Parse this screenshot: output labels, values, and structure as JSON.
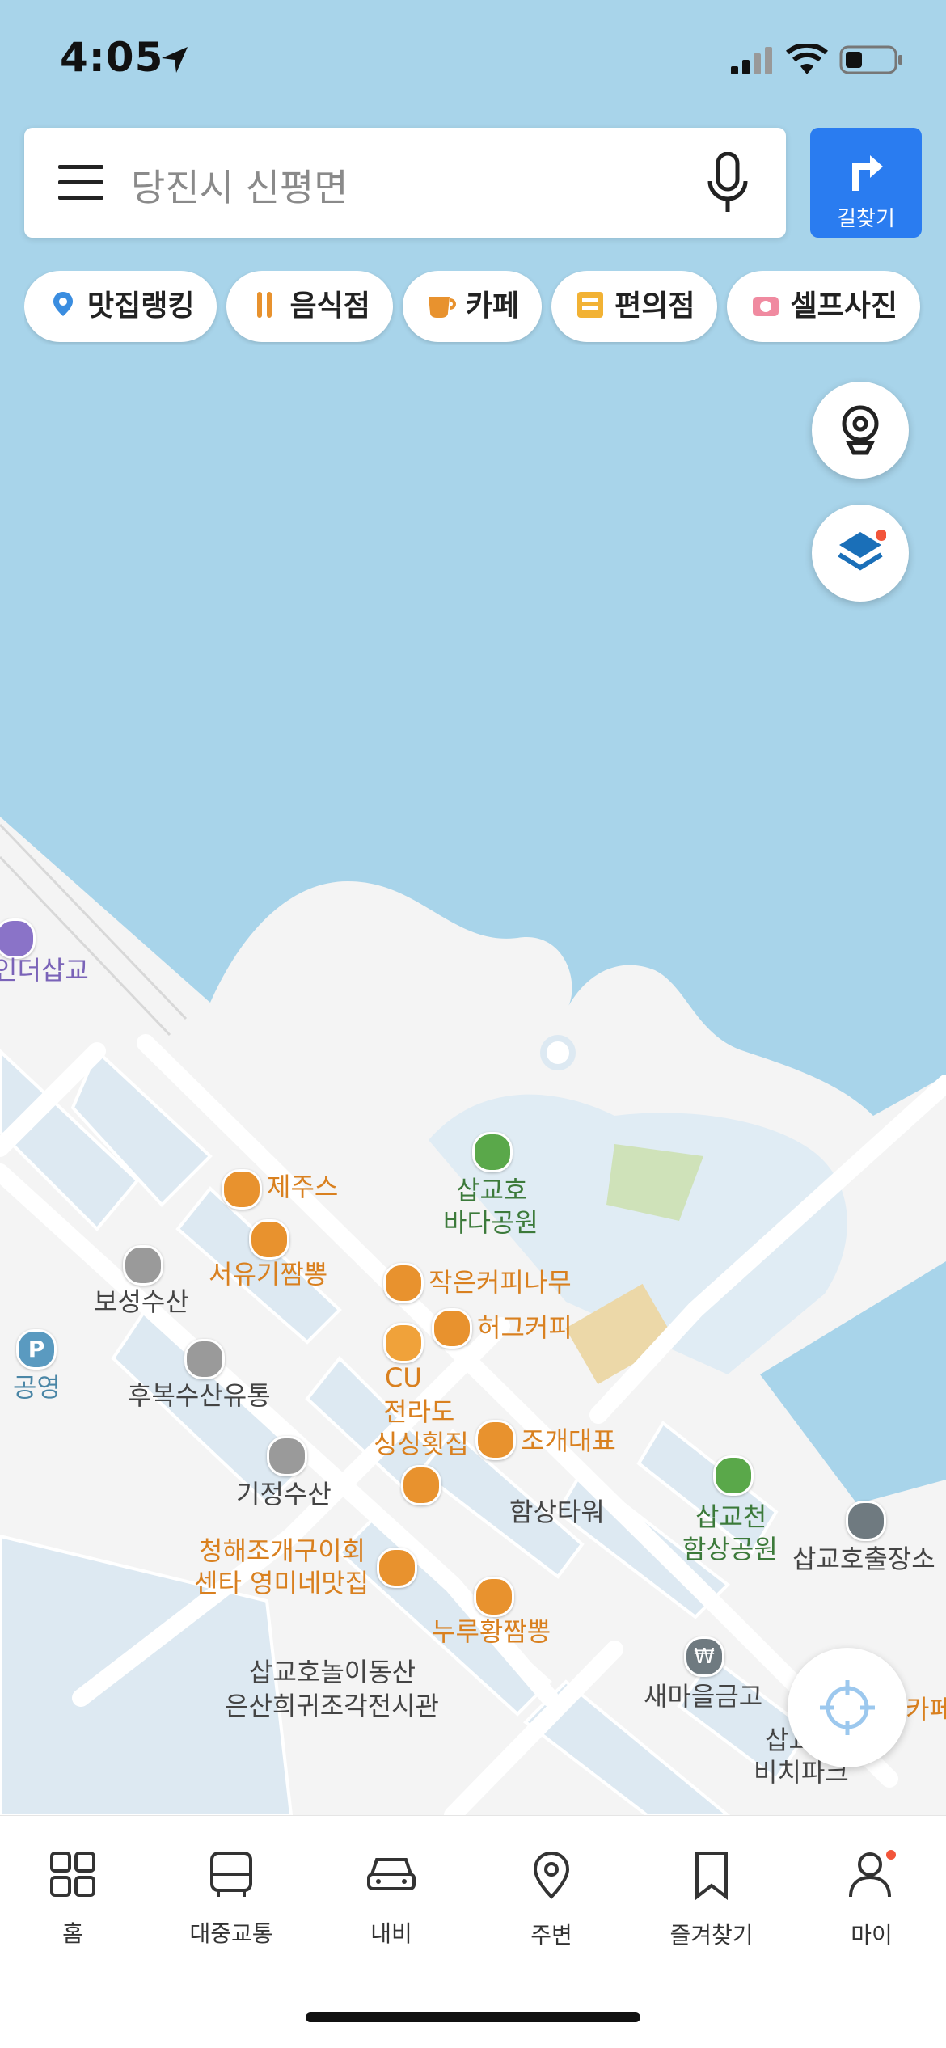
{
  "status_bar": {
    "time": "4:05"
  },
  "search": {
    "placeholder": "당진시 신평면"
  },
  "route_button": {
    "label": "길찾기"
  },
  "chips": [
    {
      "label": "맛집랭킹",
      "icon": "ranking-pin-icon"
    },
    {
      "label": "음식점",
      "icon": "utensils-icon"
    },
    {
      "label": "카페",
      "icon": "coffee-cup-icon"
    },
    {
      "label": "편의점",
      "icon": "24h-store-icon"
    },
    {
      "label": "셀프사진",
      "icon": "camera-icon"
    }
  ],
  "map_labels": {
    "inder": "인더삽교",
    "jejus": "제주스",
    "park_sea_1": "삽교호",
    "park_sea_2": "바다공원",
    "seoyugi": "서유기짬뽕",
    "boseong": "보성수산",
    "small_coffee": "작은커피나무",
    "hug": "허그커피",
    "parking": "공영",
    "cu": "CU",
    "hubok": "후복수산유통",
    "jeolla": "전라도",
    "singsing": "싱싱횟집",
    "jogae": "조개대표",
    "gijeong": "기정수산",
    "hamsang_tower": "함상타워",
    "hamsang_park_1": "삽교천",
    "hamsang_park_2": "함상공원",
    "police": "삽교호출장소",
    "cheonghae_1": "청해조개구이회",
    "cheonghae_2": "센타 영미네맛집",
    "nurung": "누루황짬뽕",
    "amuse_1": "삽교호놀이동산",
    "amuse_2": "은산희귀조각전시관",
    "saemaeul": "새마을금고",
    "beach_1": "삽교",
    "beach_2": "비치파크",
    "cafe_edge": "카페"
  },
  "parking_glyph": "P",
  "bank_glyph": "₩",
  "tabs": [
    {
      "label": "홈",
      "icon": "grid-icon"
    },
    {
      "label": "대중교통",
      "icon": "bus-icon"
    },
    {
      "label": "내비",
      "icon": "car-icon"
    },
    {
      "label": "주변",
      "icon": "location-pin-icon"
    },
    {
      "label": "즐겨찾기",
      "icon": "bookmark-icon"
    },
    {
      "label": "마이",
      "icon": "person-icon"
    }
  ],
  "colors": {
    "water": "#a8d4ea",
    "land": "#f4f4f4",
    "accent": "#2a7cf0",
    "poi_food": "#e8922e",
    "poi_park": "#5aa84a"
  }
}
